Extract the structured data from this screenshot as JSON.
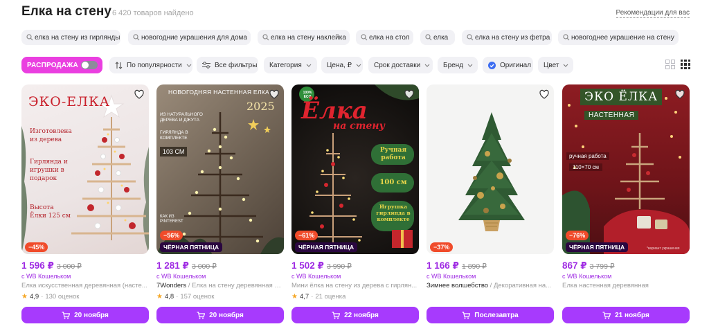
{
  "header": {
    "title": "Елка на стену",
    "count": "6 420 товаров найдено",
    "recommendations": "Рекомендации для вас"
  },
  "suggestions": [
    "елка на стену из гирлянды",
    "новогодние украшения для дома",
    "елка на стену наклейка",
    "елка на стол",
    "елка",
    "елка на стену из фетра",
    "новогоднее украшение на стену"
  ],
  "filters": {
    "sale": "РАСПРОДАЖА",
    "sort": "По популярности",
    "all_filters": "Все фильтры",
    "category": "Категория",
    "price": "Цена, ₽",
    "delivery": "Срок доставки",
    "brand": "Бренд",
    "original": "Оригинал",
    "color": "Цвет"
  },
  "colors": {
    "accent": "#a73afd",
    "price": "#9f2be3",
    "sale_pill": "#ea3fe0",
    "discount": "#f04b2a",
    "black_friday": "#2a0740"
  },
  "products": [
    {
      "price": "1 596 ₽",
      "old_price": "3 000 ₽",
      "wallet": "с WB Кошельком",
      "brand": "",
      "title": "Елка искусственная деревянная (насте...",
      "rating": "4,9",
      "reviews": "130 оценок",
      "discount": "−45%",
      "badge": "",
      "cart": "20 ноября",
      "image_text": {
        "title": "ЭКО-ЕЛКА",
        "line1": "Изготовлена из дерева",
        "line2": "Гирлянда и игрушки в подарок",
        "line3": "Высота Ёлки 125 см"
      }
    },
    {
      "price": "1 281 ₽",
      "old_price": "3 000 ₽",
      "wallet": "с WB Кошельком",
      "brand": "7Wonders",
      "title": " / Елка на стену деревянная Н...",
      "rating": "4,8",
      "reviews": "157 оценок",
      "discount": "−56%",
      "badge": "ЧЁРНАЯ ПЯТНИЦА",
      "cart": "20 ноября",
      "image_text": {
        "title": "НОВОГОДНЯЯ НАСТЕННАЯ ЕЛКА",
        "year": "2025",
        "line1": "ИЗ НАТУРАЛЬНОГО ДЕРЕВА И ДЖУТА",
        "line2": "ГИРЛЯНДА В КОМПЛЕКТЕ",
        "size": "103 СМ",
        "line3": "КАК ИЗ PINTEREST"
      }
    },
    {
      "price": "1 502 ₽",
      "old_price": "3 990 ₽",
      "wallet": "с WB Кошельком",
      "brand": "",
      "title": "Мини ёлка на стену из дерева с гирлян...",
      "rating": "4,7",
      "reviews": "21 оценка",
      "discount": "−61%",
      "badge": "ЧЁРНАЯ ПЯТНИЦА",
      "cart": "22 ноября",
      "image_text": {
        "eco": "100% ECO",
        "title": "Ёлка",
        "subtitle": "на стену",
        "line1": "Ручная работа",
        "line2": "100 см",
        "line3": "Игрушка гирлянда в комплекте"
      }
    },
    {
      "price": "1 166 ₽",
      "old_price": "1 890 ₽",
      "wallet": "с WB Кошельком",
      "brand": "Зимнее волшебство",
      "title": " / Декоративная на...",
      "rating": "",
      "reviews": "",
      "discount": "−37%",
      "badge": "",
      "cart": "Послезавтра",
      "image_text": {}
    },
    {
      "price": "867 ₽",
      "old_price": "3 799 ₽",
      "wallet": "с WB Кошельком",
      "brand": "",
      "title": "Елка настенная деревянная",
      "rating": "",
      "reviews": "",
      "discount": "−76%",
      "badge": "ЧЁРНАЯ ПЯТНИЦА",
      "cart": "21 ноября",
      "image_text": {
        "title": "ЭКО ЁЛКА",
        "subtitle": "НАСТЕННАЯ",
        "line1": "ручная работа",
        "size": "110×70 см",
        "note": "*вариант украшения"
      }
    }
  ]
}
